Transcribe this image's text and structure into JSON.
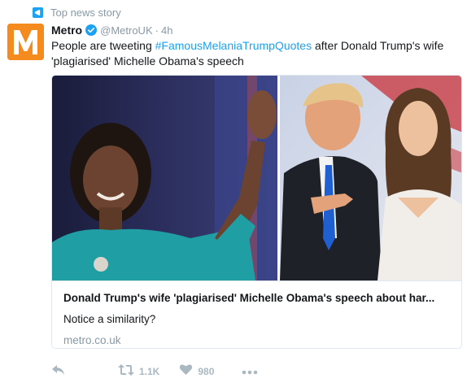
{
  "context": {
    "label": "Top news story",
    "icon": "megaphone-icon"
  },
  "tweet": {
    "author_name": "Metro",
    "handle": "@MetroUK",
    "separator": "·",
    "time": "4h",
    "avatar_letter": "M",
    "text_before": "People are tweeting ",
    "hashtag": "#FamousMelaniaTrumpQuotes",
    "text_after": " after Donald Trump's wife 'plagiarised' Michelle Obama's speech"
  },
  "card": {
    "title": "Donald Trump's wife 'plagiarised' Michelle Obama's speech about har...",
    "description": "Notice a similarity?",
    "url": "metro.co.uk"
  },
  "actions": {
    "reply_icon": "reply-icon",
    "retweet_icon": "retweet-icon",
    "retweet_count": "1.1K",
    "like_icon": "heart-icon",
    "like_count": "980",
    "more_icon": "more-icon"
  },
  "colors": {
    "accent": "#1da1f2",
    "brand_orange": "#f58a1f",
    "secondary_text": "#8899a6"
  }
}
